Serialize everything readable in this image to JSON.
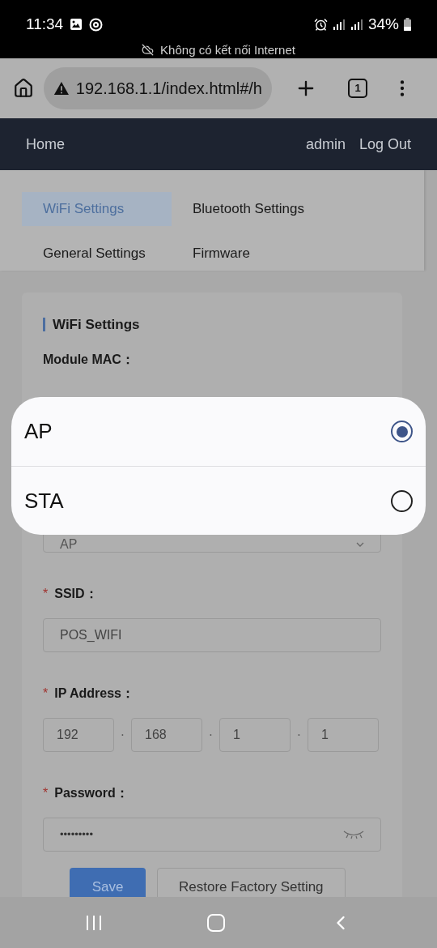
{
  "status_bar": {
    "time": "11:34",
    "battery": "34%",
    "notice": "Không có kết nối Internet"
  },
  "browser": {
    "url": "192.168.1.1/index.html#/h",
    "tab_count": "1"
  },
  "nav": {
    "home": "Home",
    "user": "admin",
    "logout": "Log Out"
  },
  "tabs": [
    {
      "label": "WiFi Settings",
      "selected": true
    },
    {
      "label": "Bluetooth Settings",
      "selected": false
    },
    {
      "label": "General Settings",
      "selected": false
    },
    {
      "label": "Firmware",
      "selected": false
    }
  ],
  "card": {
    "title": "WiFi Settings",
    "fields": [
      {
        "kind": "static",
        "label": "Module MAC："
      },
      {
        "kind": "select",
        "value": "AP"
      },
      {
        "kind": "text",
        "required_mark": "*",
        "label": "SSID：",
        "value": "POS_WIFI"
      },
      {
        "kind": "ip",
        "required_mark": "*",
        "label": "IP Address：",
        "parts": [
          "192",
          "168",
          "1",
          "1"
        ],
        "separator": "·"
      },
      {
        "kind": "password",
        "required_mark": "*",
        "label": "Password：",
        "value": "•••••••••"
      }
    ],
    "buttons": [
      {
        "label": "Save",
        "kind": "primary"
      },
      {
        "label": "Restore Factory Setting",
        "kind": "default"
      }
    ]
  },
  "options": [
    {
      "label": "AP",
      "selected": true
    },
    {
      "label": "STA",
      "selected": false
    }
  ]
}
